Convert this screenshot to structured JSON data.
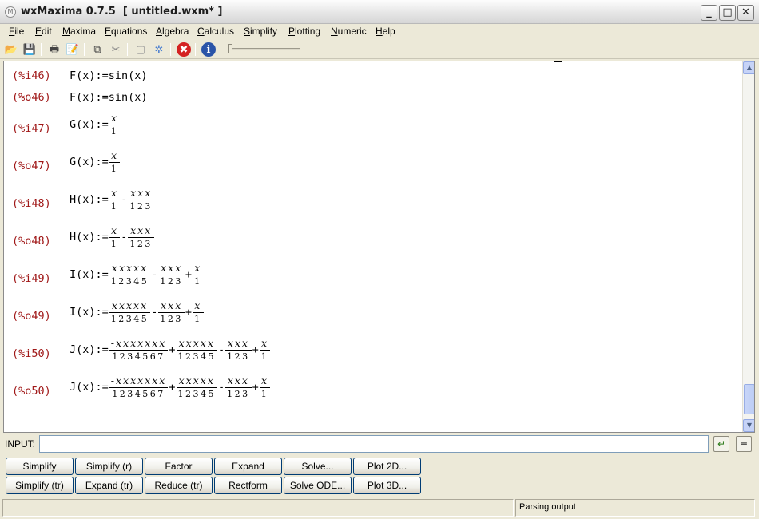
{
  "window": {
    "title": "wxMaxima 0.7.5  [ untitled.wxm* ]",
    "icon": "maxima-logo-icon",
    "minimize_label": "_",
    "maximize_label": "□",
    "close_label": "✕"
  },
  "menu": [
    {
      "accel": "F",
      "rest": "ile"
    },
    {
      "accel": "E",
      "rest": "dit"
    },
    {
      "accel": "M",
      "rest": "axima"
    },
    {
      "accel": "E",
      "rest": "quations"
    },
    {
      "accel": "A",
      "rest": "lgebra"
    },
    {
      "accel": "C",
      "rest": "alculus"
    },
    {
      "accel": "S",
      "rest": "implify"
    },
    {
      "accel": "P",
      "rest": "lotting"
    },
    {
      "accel": "N",
      "rest": "umeric"
    },
    {
      "accel": "H",
      "rest": "elp"
    }
  ],
  "toolbar": {
    "icons": [
      "open-folder-icon",
      "save-icon",
      "print-icon",
      "preferences-icon",
      "copy-icon",
      "cut-icon",
      "select-all-icon",
      "interrupt-gear-icon",
      "stop-icon",
      "info-icon"
    ],
    "glyphs": {
      "open": "📂",
      "save": "💾",
      "print": "🖶",
      "prefs": "📝",
      "copy": "⧉",
      "cut": "✂",
      "page": "▢",
      "gear": "✲",
      "stop": "✖",
      "info": "i"
    }
  },
  "cells": [
    {
      "label": "(%i46)",
      "name": "F",
      "op": "(x):=",
      "type": "text",
      "rhs": "sin(x)"
    },
    {
      "label": "(%o46)",
      "name": "F",
      "op": "(x):=",
      "type": "text",
      "rhs": "sin(x)"
    },
    {
      "label": "(%i47)",
      "name": "G",
      "op": "(x):=",
      "type": "frac",
      "terms": [
        {
          "sign": "",
          "num": "x",
          "den": "1"
        }
      ]
    },
    {
      "label": "(%o47)",
      "name": "G",
      "op": "(x):=",
      "type": "frac",
      "terms": [
        {
          "sign": "",
          "num": "x",
          "den": "1"
        }
      ]
    },
    {
      "label": "(%i48)",
      "name": "H",
      "op": "(x):=",
      "type": "frac",
      "terms": [
        {
          "sign": "",
          "num": "x",
          "den": "1"
        },
        {
          "sign": "-",
          "num": "xxx",
          "den": "123"
        }
      ]
    },
    {
      "label": "(%o48)",
      "name": "H",
      "op": "(x):=",
      "type": "frac",
      "terms": [
        {
          "sign": "",
          "num": "x",
          "den": "1"
        },
        {
          "sign": "-",
          "num": "xxx",
          "den": "123"
        }
      ]
    },
    {
      "label": "(%i49)",
      "name": "I",
      "op": "(x):=",
      "type": "frac",
      "terms": [
        {
          "sign": "",
          "num": "xxxxx",
          "den": "12345"
        },
        {
          "sign": "-",
          "num": "xxx",
          "den": "123"
        },
        {
          "sign": "+",
          "num": "x",
          "den": "1"
        }
      ]
    },
    {
      "label": "(%o49)",
      "name": "I",
      "op": "(x):=",
      "type": "frac",
      "terms": [
        {
          "sign": "",
          "num": "xxxxx",
          "den": "12345"
        },
        {
          "sign": "-",
          "num": "xxx",
          "den": "123"
        },
        {
          "sign": "+",
          "num": "x",
          "den": "1"
        }
      ]
    },
    {
      "label": "(%i50)",
      "name": "J",
      "op": "(x):=",
      "type": "frac",
      "terms": [
        {
          "sign": "",
          "num": "-xxxxxxx",
          "den": "1234567"
        },
        {
          "sign": "+",
          "num": "xxxxx",
          "den": "12345"
        },
        {
          "sign": "-",
          "num": "xxx",
          "den": "123"
        },
        {
          "sign": "+",
          "num": "x",
          "den": "1"
        }
      ]
    },
    {
      "label": "(%o50)",
      "name": "J",
      "op": "(x):=",
      "type": "frac",
      "terms": [
        {
          "sign": "",
          "num": "-xxxxxxx",
          "den": "1234567"
        },
        {
          "sign": "+",
          "num": "xxxxx",
          "den": "12345"
        },
        {
          "sign": "-",
          "num": "xxx",
          "den": "123"
        },
        {
          "sign": "+",
          "num": "x",
          "den": "1"
        }
      ]
    }
  ],
  "scrollbar": {
    "up": "▲",
    "down": "▼"
  },
  "input": {
    "label": "INPUT:",
    "value": "",
    "enter_glyph": "↵",
    "history_glyph": "≡"
  },
  "buttons": {
    "row1": [
      "Simplify",
      "Simplify (r)",
      "Factor",
      "Expand",
      "Solve...",
      "Plot 2D..."
    ],
    "row2": [
      "Simplify (tr)",
      "Expand (tr)",
      "Reduce (tr)",
      "Rectform",
      "Solve ODE...",
      "Plot 3D..."
    ]
  },
  "status": {
    "text": "Parsing output"
  }
}
